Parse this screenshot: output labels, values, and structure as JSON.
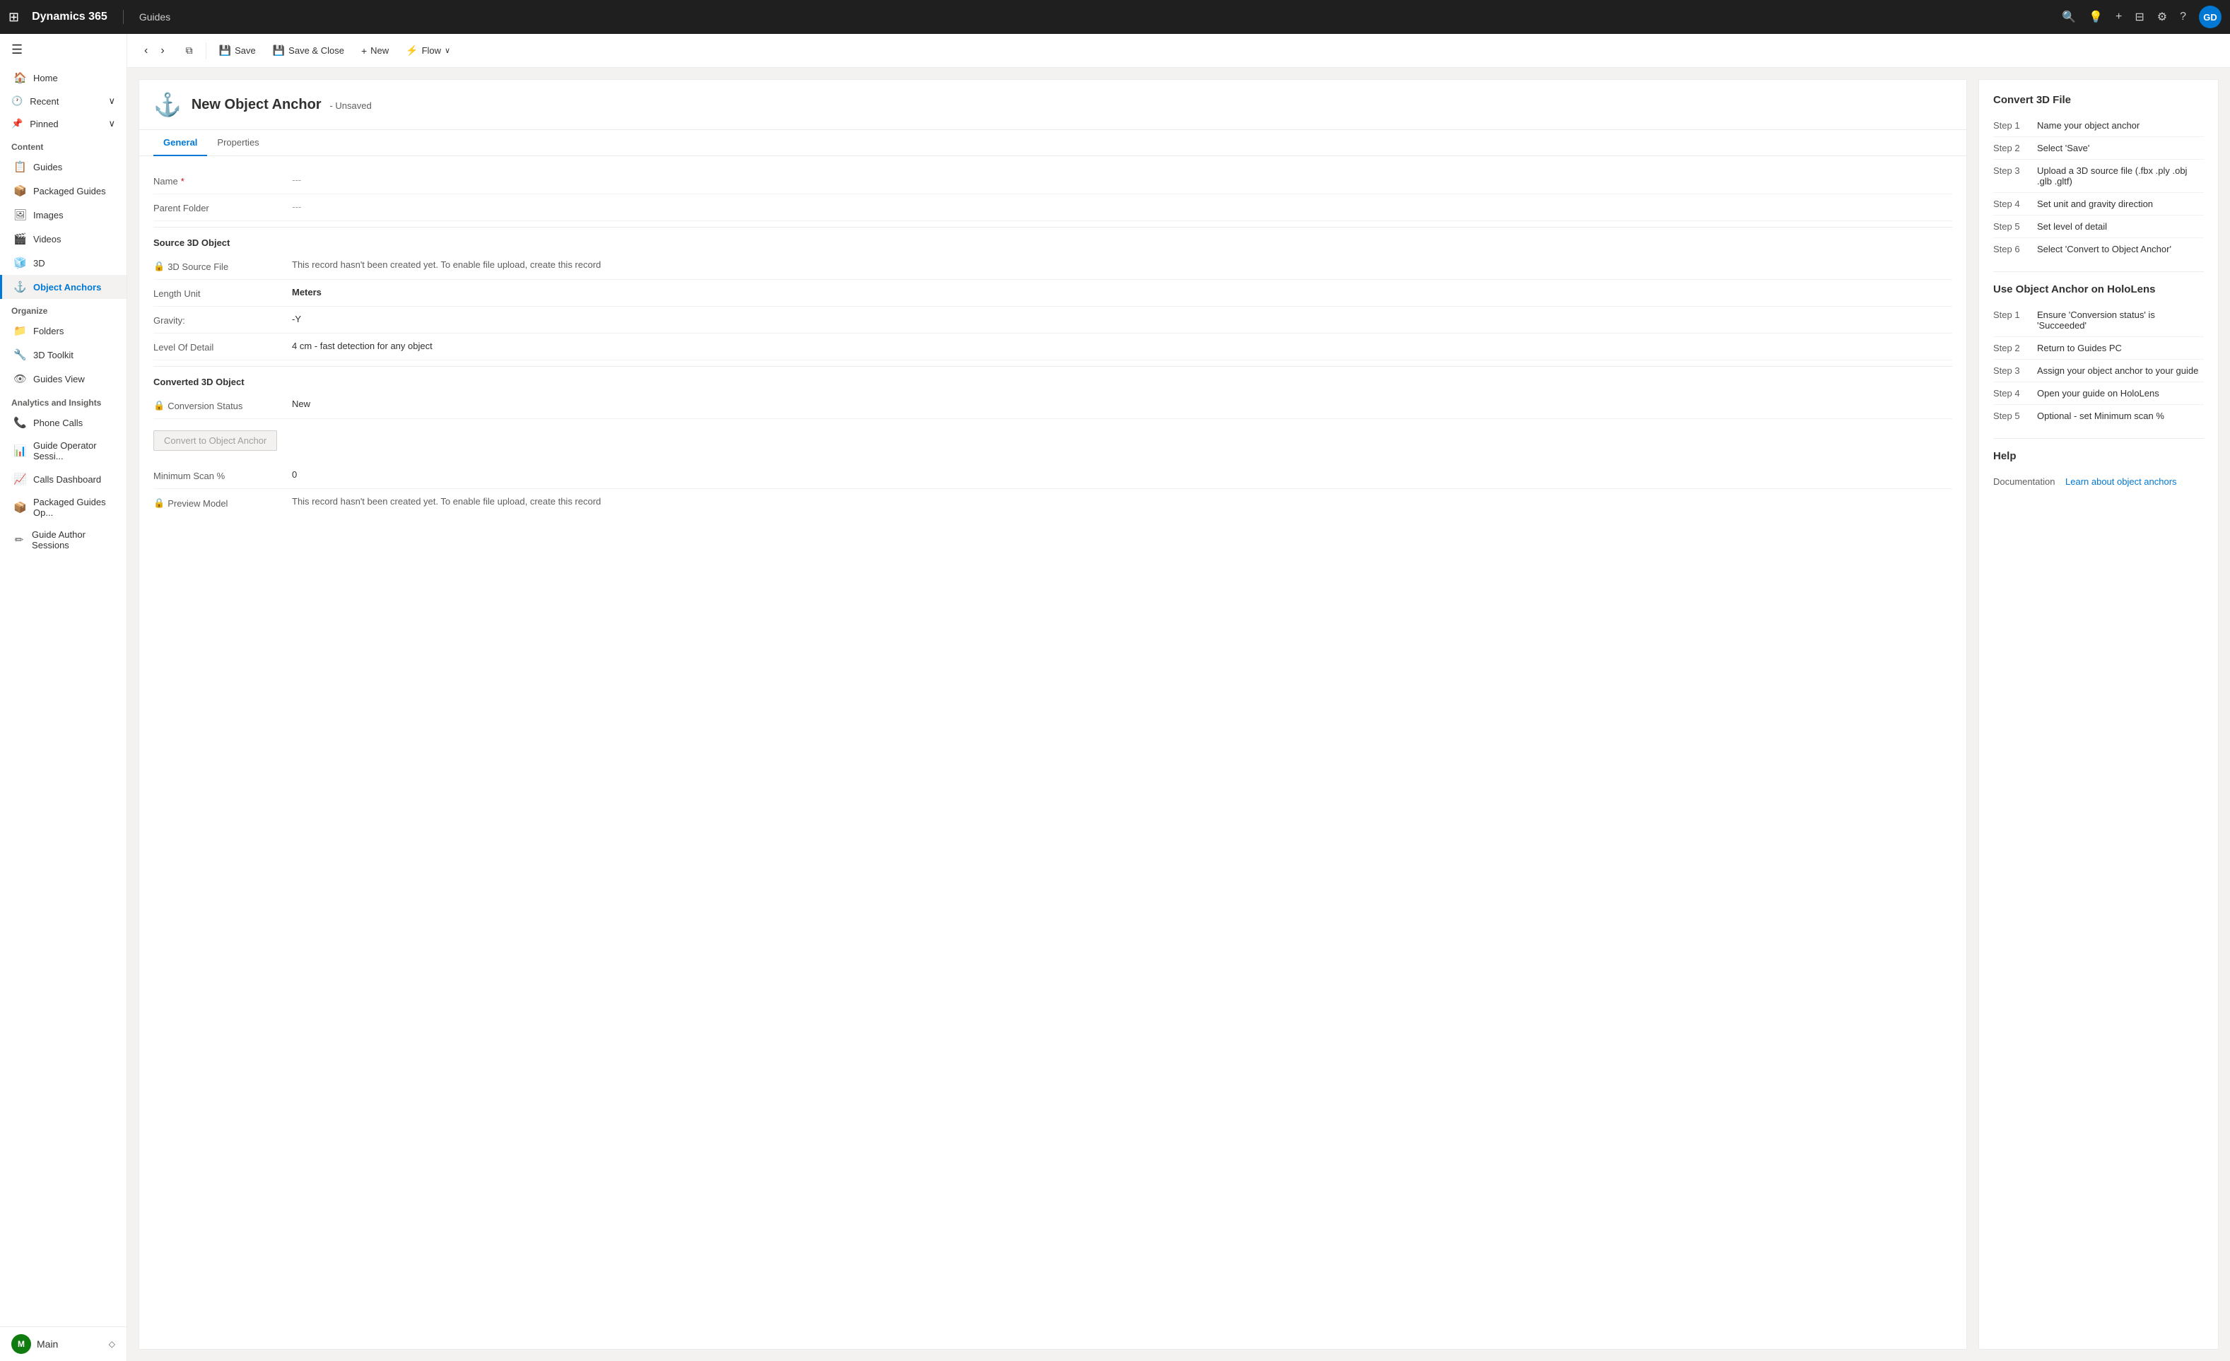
{
  "topNav": {
    "appTitle": "Dynamics 365",
    "sectionLabel": "Guides",
    "icons": {
      "waffle": "⊞",
      "search": "🔍",
      "lightbulb": "💡",
      "plus": "+",
      "filter": "⊟",
      "settings": "⚙",
      "help": "?",
      "avatarInitials": "GD"
    }
  },
  "toolbar": {
    "backLabel": "‹",
    "forwardLabel": "›",
    "newWindowLabel": "⧉",
    "saveLabel": "Save",
    "saveAndCloseLabel": "Save & Close",
    "newLabel": "New",
    "flowLabel": "Flow",
    "chevron": "∨"
  },
  "formHeader": {
    "icon": "⚓",
    "title": "New Object Anchor",
    "subtitle": "- Unsaved"
  },
  "tabs": [
    {
      "label": "General",
      "active": true
    },
    {
      "label": "Properties",
      "active": false
    }
  ],
  "formSections": {
    "basic": {
      "nameLabel": "Name",
      "nameRequired": true,
      "nameValue": "---",
      "parentFolderLabel": "Parent Folder",
      "parentFolderValue": "---"
    },
    "source3D": {
      "sectionTitle": "Source 3D Object",
      "sourceFileLabel": "3D Source File",
      "sourceFileValue": "This record hasn't been created yet. To enable file upload, create this record",
      "lengthUnitLabel": "Length Unit",
      "lengthUnitValue": "Meters",
      "gravityLabel": "Gravity:",
      "gravityValue": "-Y",
      "levelOfDetailLabel": "Level Of Detail",
      "levelOfDetailValue": "4 cm - fast detection for any object"
    },
    "converted3D": {
      "sectionTitle": "Converted 3D Object",
      "conversionStatusLabel": "Conversion Status",
      "conversionStatusValue": "New",
      "convertButtonLabel": "Convert to Object Anchor",
      "minimumScanLabel": "Minimum Scan %",
      "minimumScanValue": "0",
      "previewModelLabel": "Preview Model",
      "previewModelValue": "This record hasn't been created yet. To enable file upload, create this record"
    }
  },
  "rightPanel": {
    "convert3DTitle": "Convert 3D File",
    "convert3DSteps": [
      {
        "label": "Step 1",
        "text": "Name your object anchor"
      },
      {
        "label": "Step 2",
        "text": "Select 'Save'"
      },
      {
        "label": "Step 3",
        "text": "Upload a 3D source file (.fbx .ply .obj .glb .gltf)"
      },
      {
        "label": "Step 4",
        "text": "Set unit and gravity direction"
      },
      {
        "label": "Step 5",
        "text": "Set level of detail"
      },
      {
        "label": "Step 6",
        "text": "Select 'Convert to Object Anchor'"
      }
    ],
    "useOnHololensTitle": "Use Object Anchor on HoloLens",
    "useOnHololensSteps": [
      {
        "label": "Step 1",
        "text": "Ensure 'Conversion status' is 'Succeeded'"
      },
      {
        "label": "Step 2",
        "text": "Return to Guides PC"
      },
      {
        "label": "Step 3",
        "text": "Assign your object anchor to your guide"
      },
      {
        "label": "Step 4",
        "text": "Open your guide on HoloLens"
      },
      {
        "label": "Step 5",
        "text": "Optional - set Minimum scan %"
      }
    ],
    "helpTitle": "Help",
    "helpDocLabel": "Documentation",
    "helpLinkText": "Learn about object anchors",
    "helpLinkUrl": "#"
  },
  "sidebar": {
    "toggleIcon": "☰",
    "homeLabel": "Home",
    "recentLabel": "Recent",
    "pinnedLabel": "Pinned",
    "contentSection": "Content",
    "contentItems": [
      {
        "id": "guides",
        "label": "Guides",
        "icon": "📋"
      },
      {
        "id": "packaged-guides",
        "label": "Packaged Guides",
        "icon": "📦"
      },
      {
        "id": "images",
        "label": "Images",
        "icon": "🖼"
      },
      {
        "id": "videos",
        "label": "Videos",
        "icon": "🎬"
      },
      {
        "id": "3d",
        "label": "3D",
        "icon": "🧊"
      },
      {
        "id": "object-anchors",
        "label": "Object Anchors",
        "icon": "⚓"
      }
    ],
    "organizeSection": "Organize",
    "organizeItems": [
      {
        "id": "folders",
        "label": "Folders",
        "icon": "📁"
      },
      {
        "id": "3d-toolkit",
        "label": "3D Toolkit",
        "icon": "🔧"
      },
      {
        "id": "guides-view",
        "label": "Guides View",
        "icon": "👁"
      }
    ],
    "analyticsSection": "Analytics and Insights",
    "analyticsItems": [
      {
        "id": "phone-calls",
        "label": "Phone Calls",
        "icon": "📞"
      },
      {
        "id": "guide-operator",
        "label": "Guide Operator Sessi...",
        "icon": "📊"
      },
      {
        "id": "calls-dashboard",
        "label": "Calls Dashboard",
        "icon": "📈"
      },
      {
        "id": "packaged-guides-op",
        "label": "Packaged Guides Op...",
        "icon": "📦"
      },
      {
        "id": "guide-author",
        "label": "Guide Author Sessions",
        "icon": "✏"
      }
    ],
    "footer": {
      "avatarInitials": "M",
      "label": "Main",
      "icon": "◇"
    }
  }
}
